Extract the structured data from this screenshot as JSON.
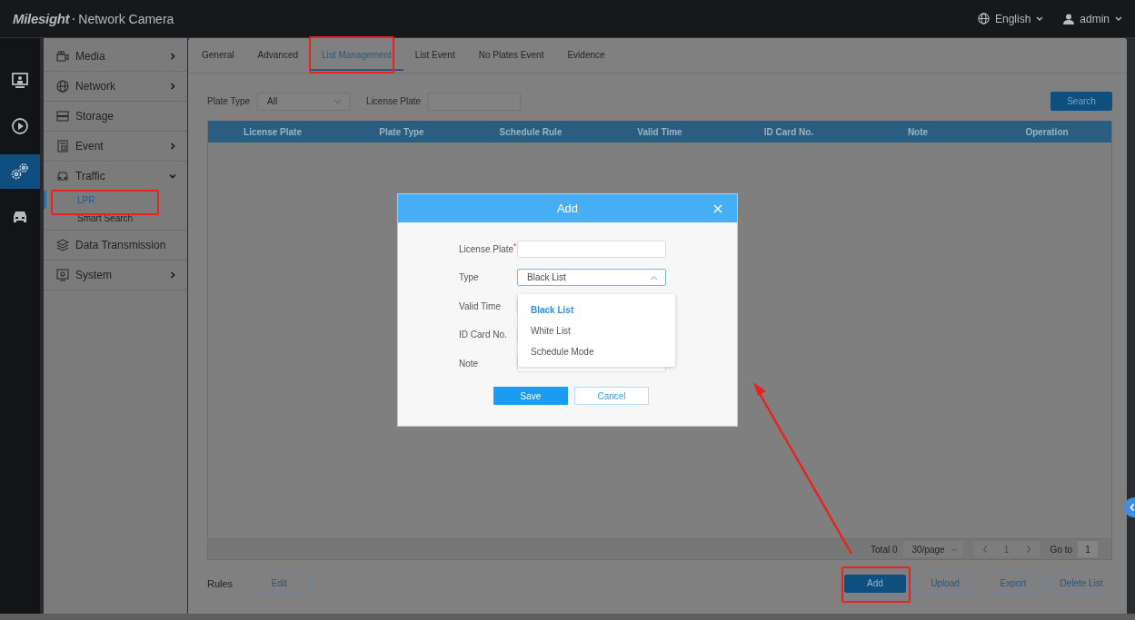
{
  "header": {
    "logo": "Milesight",
    "title": "Network Camera",
    "language": "English",
    "user": "admin"
  },
  "rail": [
    {
      "selected": false
    },
    {
      "selected": false
    },
    {
      "selected": true
    },
    {
      "selected": false
    }
  ],
  "sidebar": {
    "items": [
      {
        "label": "Media",
        "expanded": false
      },
      {
        "label": "Network",
        "expanded": false
      },
      {
        "label": "Storage"
      },
      {
        "label": "Event",
        "expanded": false
      },
      {
        "label": "Traffic",
        "expanded": true,
        "children": [
          {
            "label": "LPR",
            "selected": true
          },
          {
            "label": "Smart Search",
            "selected": false
          }
        ]
      },
      {
        "label": "Data Transmission"
      },
      {
        "label": "System",
        "expanded": false
      }
    ]
  },
  "tabs": [
    {
      "label": "General",
      "selected": false
    },
    {
      "label": "Advanced",
      "selected": false
    },
    {
      "label": "List Management",
      "selected": true
    },
    {
      "label": "List Event",
      "selected": false
    },
    {
      "label": "No Plates Event",
      "selected": false
    },
    {
      "label": "Evidence",
      "selected": false
    }
  ],
  "filters": {
    "plate_type_label": "Plate Type",
    "plate_type_value": "All",
    "license_plate_label": "License Plate",
    "search_button": "Search"
  },
  "table": {
    "columns": [
      "License Plate",
      "Plate Type",
      "Schedule Rule",
      "Valid Time",
      "ID Card No.",
      "Note",
      "Operation"
    ]
  },
  "pagination": {
    "total": "Total 0",
    "page_size": "30/page",
    "page": "1",
    "goto_label": "Go to",
    "goto_value": "1"
  },
  "footer": {
    "rules_label": "Rules",
    "edit_button": "Edit",
    "buttons": [
      {
        "label": "Add",
        "kind": "primary"
      },
      {
        "label": "Upload",
        "kind": "outline"
      },
      {
        "label": "Export",
        "kind": "outline"
      },
      {
        "label": "Delete List",
        "kind": "outline"
      }
    ]
  },
  "dialog": {
    "title": "Add",
    "fields": [
      {
        "label": "License Plate$^{*}$",
        "kind": "text"
      },
      {
        "label": "Type",
        "kind": "select",
        "value": "Black List"
      },
      {
        "label": "Valid Time",
        "kind": "text"
      },
      {
        "label": "ID Card No.",
        "kind": "text"
      },
      {
        "label": "Note",
        "kind": "text"
      }
    ],
    "options": [
      {
        "label": "Black List",
        "selected": true
      },
      {
        "label": "White List",
        "selected": false
      },
      {
        "label": "Schedule Mode",
        "selected": false
      }
    ],
    "save": "Save",
    "cancel": "Cancel"
  }
}
